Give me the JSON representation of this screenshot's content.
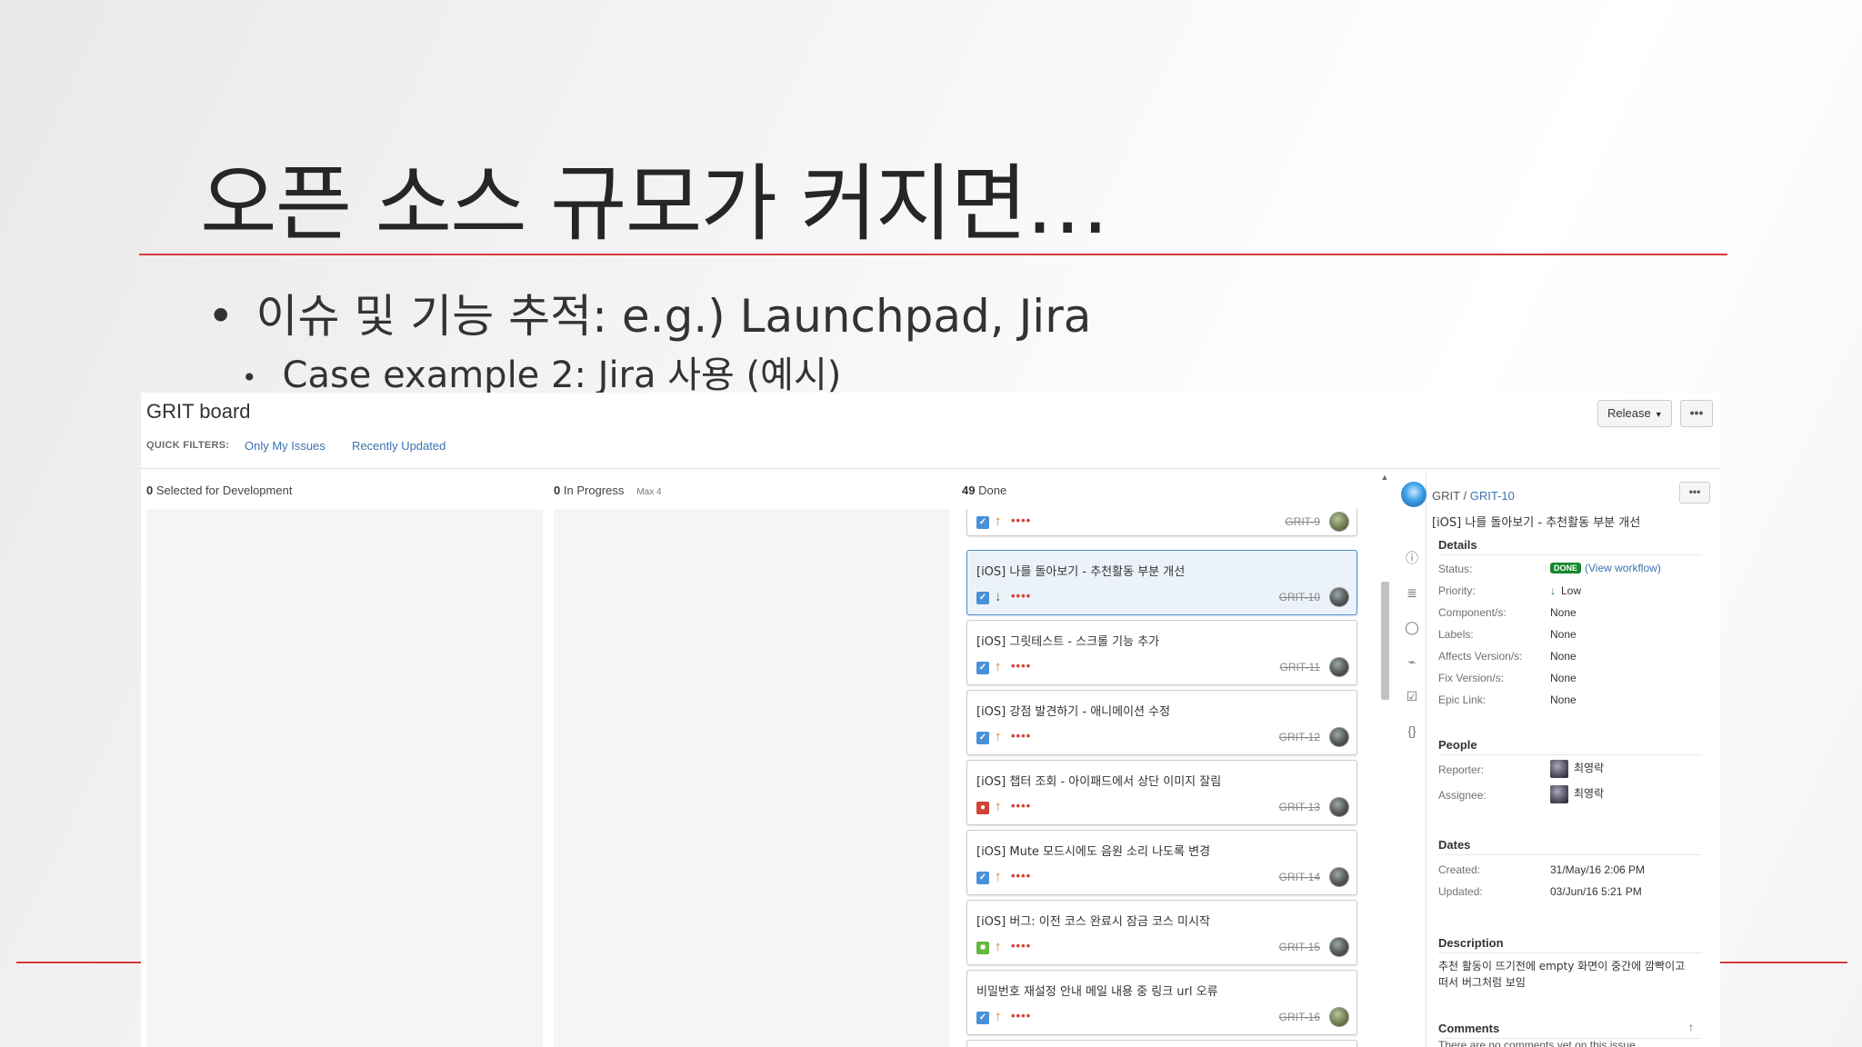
{
  "slide": {
    "title": "오픈 소스 규모가 커지면…",
    "bullet1": "이슈 및 기능 추적: e.g.) Launchpad, Jira",
    "bullet2": "Case example 2: Jira 사용 (예시)",
    "bullet_glyph": "•",
    "accent_color": "#d93a3a"
  },
  "board": {
    "title": "GRIT board",
    "quick_filters_label": "QUICK FILTERS:",
    "filters": [
      "Only My Issues",
      "Recently Updated"
    ],
    "release_label": "Release",
    "more_label": "•••",
    "columns": [
      {
        "count": "0",
        "name": "Selected for Development",
        "max": ""
      },
      {
        "count": "0",
        "name": "In Progress",
        "max": "Max 4"
      },
      {
        "count": "49",
        "name": "Done",
        "max": ""
      }
    ],
    "cards": [
      {
        "summary": "",
        "type": "task",
        "priority": "up",
        "key": "GRIT-9",
        "avatar": "green"
      },
      {
        "summary": "[iOS] 나를 돌아보기 - 추천활동 부분 개선",
        "type": "task",
        "priority": "down",
        "key": "GRIT-10",
        "avatar": "grey",
        "selected": true
      },
      {
        "summary": "[iOS] 그릿테스트 - 스크롤 기능 추가",
        "type": "task",
        "priority": "up",
        "key": "GRIT-11",
        "avatar": "grey"
      },
      {
        "summary": "[iOS] 강점 발견하기 - 애니메이션 수정",
        "type": "task",
        "priority": "up",
        "key": "GRIT-12",
        "avatar": "grey"
      },
      {
        "summary": "[iOS] 챕터 조회 - 아이패드에서 상단 이미지 잘림",
        "type": "bug",
        "priority": "up",
        "key": "GRIT-13",
        "avatar": "grey"
      },
      {
        "summary": "[iOS] Mute 모드시에도 음원 소리 나도록 변경",
        "type": "task",
        "priority": "up",
        "key": "GRIT-14",
        "avatar": "grey"
      },
      {
        "summary": "[iOS] 버그: 이전 코스 완료시 잠금 코스 미시작",
        "type": "story",
        "priority": "up",
        "key": "GRIT-15",
        "avatar": "grey"
      },
      {
        "summary": "비밀번호 재설정 안내 메일 내용 중 링크 url 오류",
        "type": "task",
        "priority": "up",
        "key": "GRIT-16",
        "avatar": "green"
      }
    ],
    "priority_dots": "••••"
  },
  "detail": {
    "project": "GRIT",
    "separator": "/",
    "issue_key": "GRIT-10",
    "summary": "[iOS] 나를 돌아보기 - 추천활동 부분 개선",
    "details_heading": "Details",
    "fields": [
      {
        "label": "Status:",
        "value": "DONE",
        "extra": "(View workflow)"
      },
      {
        "label": "Priority:",
        "value": "Low"
      },
      {
        "label": "Component/s:",
        "value": "None"
      },
      {
        "label": "Labels:",
        "value": "None"
      },
      {
        "label": "Affects Version/s:",
        "value": "None"
      },
      {
        "label": "Fix Version/s:",
        "value": "None"
      },
      {
        "label": "Epic Link:",
        "value": "None"
      }
    ],
    "people_heading": "People",
    "reporter_label": "Reporter:",
    "reporter": "최영락",
    "assignee_label": "Assignee:",
    "assignee": "최영락",
    "dates_heading": "Dates",
    "created_label": "Created:",
    "created": "31/May/16 2:06 PM",
    "updated_label": "Updated:",
    "updated": "03/Jun/16 5:21 PM",
    "description_heading": "Description",
    "description": "추천 활동이 뜨기전에 empty 화면이 중간에 깜빡이고 떠서 버그처럼 보임",
    "comments_heading": "Comments",
    "comments_text": "There are no comments yet on this issue."
  },
  "icons": [
    "info-icon",
    "description-icon",
    "comment-icon",
    "attachment-icon",
    "subtask-icon",
    "code-icon"
  ]
}
